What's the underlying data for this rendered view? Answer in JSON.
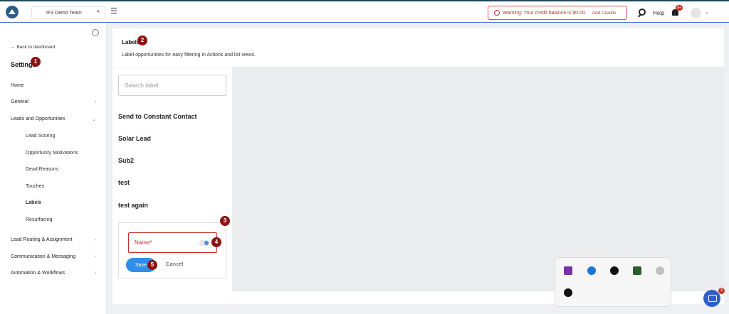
{
  "topbar": {
    "team": "IF3 Demo Team",
    "warning": "Warning: Your credit balance is $0.00.",
    "add_credits": "Add Credits",
    "help": "Help",
    "bell_badge": "9+"
  },
  "sidebar": {
    "back": "Back to dashboard",
    "title": "Settings",
    "items": [
      {
        "label": "Home"
      },
      {
        "label": "General"
      },
      {
        "label": "Leads and Opportunities"
      },
      {
        "label": "Lead Routing & Assignment"
      },
      {
        "label": "Communication & Messaging"
      },
      {
        "label": "Automation & Workflows"
      }
    ],
    "subitems": [
      {
        "label": "Lead Scoring"
      },
      {
        "label": "Opportunity Motivations"
      },
      {
        "label": "Dead Reasons"
      },
      {
        "label": "Touches"
      },
      {
        "label": "Labels"
      },
      {
        "label": "Resurfacing"
      }
    ]
  },
  "header": {
    "title": "Labels",
    "subtitle": "Label opportunities for easy filtering in Actions and list views."
  },
  "labels": {
    "search_placeholder": "Search label",
    "items": [
      "Send to Constant Contact",
      "Solar Lead",
      "Sub2",
      "test",
      "test again"
    ]
  },
  "form": {
    "name_placeholder": "Name*",
    "save": "Save",
    "cancel": "Cancel"
  },
  "markers": [
    "1",
    "2",
    "3",
    "4",
    "5"
  ],
  "chat": {
    "badge": "3"
  }
}
